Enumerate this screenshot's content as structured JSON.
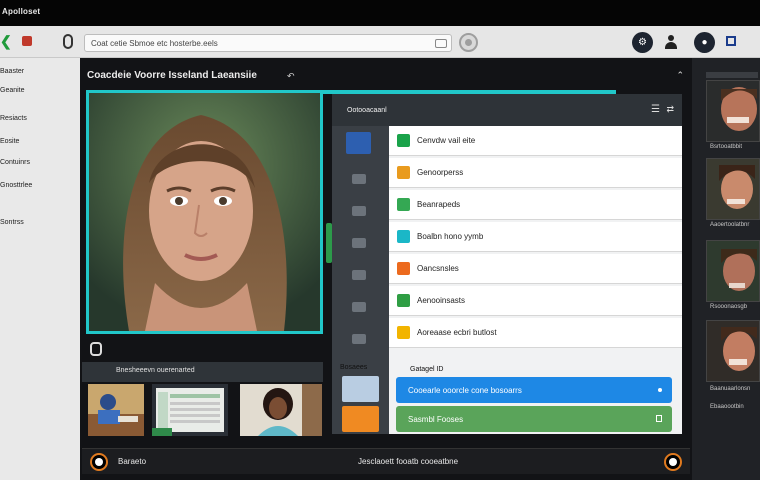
{
  "window": {
    "title": "Apolloset"
  },
  "toolbar": {
    "back_icon": "chevron-left-icon",
    "url": "Coat cetie Sbmoe etc hosterbe.eels",
    "buttons": [
      "record-icon",
      "gear-icon",
      "user-icon",
      "mic-icon",
      "square-icon"
    ]
  },
  "sidebar": {
    "items": [
      {
        "label": "Baaster"
      },
      {
        "label": "Geanite"
      },
      {
        "label": "Resiacts"
      },
      {
        "label": "Eosite"
      },
      {
        "label": "Contuinrs"
      },
      {
        "label": "Gnosttrlee"
      },
      {
        "label": "Sontrss"
      }
    ]
  },
  "main": {
    "title": "Coacdeie Voorre Isseland Laeansiie",
    "title_icon": "share-icon",
    "collapse_icon": "chevron-up-icon",
    "strip_label": "Bnesheeevn ouerenarted",
    "footer_left": "Baraeto",
    "footer_center": "Jesclaoett fooatb cooeatbne"
  },
  "panel": {
    "title": "Ootooacaanl",
    "menu_icon": "hamburger-icon",
    "close_icon": "close-icon",
    "apps": [
      {
        "label": "Cenvdw vail eite",
        "color": "#1aa34a"
      },
      {
        "label": "Genoorperss",
        "color": "#e99b1e"
      },
      {
        "label": "Beanrapeds",
        "color": "#34a853"
      },
      {
        "label": "Boalbn hono yymb",
        "color": "#1bb7c7"
      },
      {
        "label": "Oancsnsles",
        "color": "#ec6a1e"
      },
      {
        "label": "Aenooinsasts",
        "color": "#2f9e44"
      },
      {
        "label": "Aoreaase ecbri butlost",
        "color": "#f2b400"
      }
    ],
    "category_label": "Bosaees",
    "settings_label": "Gatagel ID",
    "blue_bar": "Cooearle ooorcle cone bosoarrs",
    "green_bar": "Sasmbl Fooses"
  },
  "rightcol": {
    "labels": [
      "Bsrtooatbbit",
      "Aaoertoolatbnr",
      "Rsooonaosgb",
      "Baanuaarlonsn",
      "Ebaaoootbin"
    ]
  }
}
